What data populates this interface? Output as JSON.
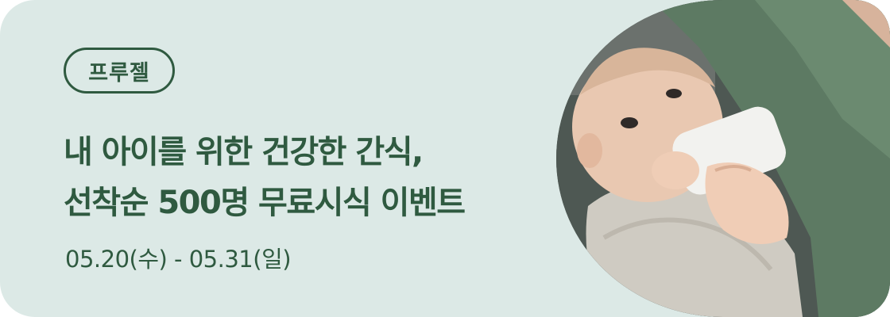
{
  "banner": {
    "badge_label": "프루젤",
    "headline_line1": "내 아이를 위한 건강한 간식,",
    "headline_line2": "선착순 500명 무료시식 이벤트",
    "date_range": "05.20(수) - 05.31(일)",
    "photo_subject": "baby-drinking-from-bottle",
    "colors": {
      "background": "#dce9e6",
      "accent": "#2f5a40"
    }
  }
}
